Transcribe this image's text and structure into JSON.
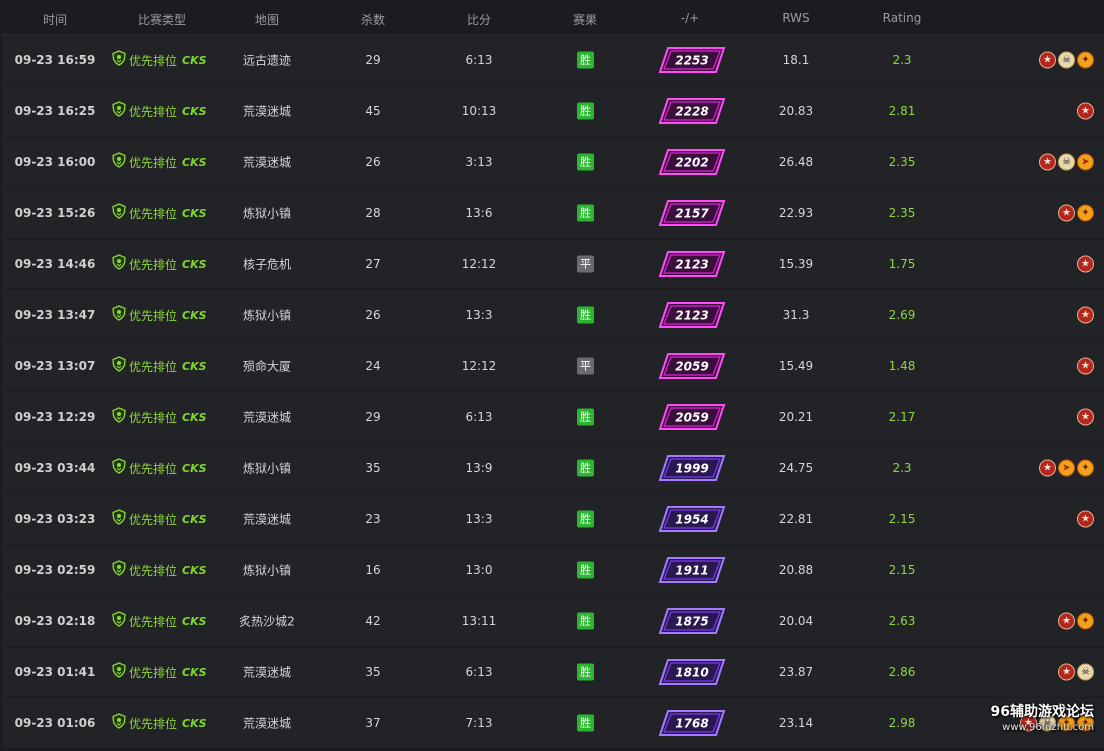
{
  "header": {
    "time": "时间",
    "type": "比赛类型",
    "map": "地图",
    "kills": "杀数",
    "score": "比分",
    "result": "赛果",
    "delta": "-/+",
    "rws": "RWS",
    "rating": "Rating"
  },
  "match_type": {
    "label": "优先排位",
    "logo": "CKS"
  },
  "result_labels": {
    "win": "胜",
    "draw": "平"
  },
  "matches": [
    {
      "time": "09-23 16:59",
      "map": "远古遗迹",
      "kills": "29",
      "score": "6:13",
      "result": "胜",
      "elo": "2253",
      "rws": "18.1",
      "rating": "2.3",
      "badges": [
        "star",
        "skull",
        "fire"
      ]
    },
    {
      "time": "09-23 16:25",
      "map": "荒漠迷城",
      "kills": "45",
      "score": "10:13",
      "result": "胜",
      "elo": "2228",
      "rws": "20.83",
      "rating": "2.81",
      "badges": [
        "star"
      ]
    },
    {
      "time": "09-23 16:00",
      "map": "荒漠迷城",
      "kills": "26",
      "score": "3:13",
      "result": "胜",
      "elo": "2202",
      "rws": "26.48",
      "rating": "2.35",
      "badges": [
        "star",
        "skull",
        "rocket"
      ]
    },
    {
      "time": "09-23 15:26",
      "map": "炼狱小镇",
      "kills": "28",
      "score": "13:6",
      "result": "胜",
      "elo": "2157",
      "rws": "22.93",
      "rating": "2.35",
      "badges": [
        "star",
        "fire"
      ]
    },
    {
      "time": "09-23 14:46",
      "map": "核子危机",
      "kills": "27",
      "score": "12:12",
      "result": "平",
      "elo": "2123",
      "rws": "15.39",
      "rating": "1.75",
      "badges": [
        "star"
      ]
    },
    {
      "time": "09-23 13:47",
      "map": "炼狱小镇",
      "kills": "26",
      "score": "13:3",
      "result": "胜",
      "elo": "2123",
      "rws": "31.3",
      "rating": "2.69",
      "badges": [
        "star"
      ]
    },
    {
      "time": "09-23 13:07",
      "map": "殒命大厦",
      "kills": "24",
      "score": "12:12",
      "result": "平",
      "elo": "2059",
      "rws": "15.49",
      "rating": "1.48",
      "badges": [
        "star"
      ]
    },
    {
      "time": "09-23 12:29",
      "map": "荒漠迷城",
      "kills": "29",
      "score": "6:13",
      "result": "胜",
      "elo": "2059",
      "rws": "20.21",
      "rating": "2.17",
      "badges": [
        "star"
      ]
    },
    {
      "time": "09-23 03:44",
      "map": "炼狱小镇",
      "kills": "35",
      "score": "13:9",
      "result": "胜",
      "elo": "1999",
      "rws": "24.75",
      "rating": "2.3",
      "badges": [
        "star",
        "rocket",
        "fire"
      ]
    },
    {
      "time": "09-23 03:23",
      "map": "荒漠迷城",
      "kills": "23",
      "score": "13:3",
      "result": "胜",
      "elo": "1954",
      "rws": "22.81",
      "rating": "2.15",
      "badges": [
        "star"
      ]
    },
    {
      "time": "09-23 02:59",
      "map": "炼狱小镇",
      "kills": "16",
      "score": "13:0",
      "result": "胜",
      "elo": "1911",
      "rws": "20.88",
      "rating": "2.15",
      "badges": []
    },
    {
      "time": "09-23 02:18",
      "map": "炙热沙城2",
      "kills": "42",
      "score": "13:11",
      "result": "胜",
      "elo": "1875",
      "rws": "20.04",
      "rating": "2.63",
      "badges": [
        "star",
        "fire"
      ]
    },
    {
      "time": "09-23 01:41",
      "map": "荒漠迷城",
      "kills": "35",
      "score": "6:13",
      "result": "胜",
      "elo": "1810",
      "rws": "23.87",
      "rating": "2.86",
      "badges": [
        "star",
        "skull"
      ]
    },
    {
      "time": "09-23 01:06",
      "map": "荒漠迷城",
      "kills": "37",
      "score": "7:13",
      "result": "胜",
      "elo": "1768",
      "rws": "23.14",
      "rating": "2.98",
      "badges": [
        "star",
        "skull",
        "fire",
        "fire"
      ]
    }
  ],
  "badge_icons": {
    "star": "★",
    "skull": "☠",
    "fire": "✦",
    "rocket": "➤"
  },
  "colors": {
    "win": "#2bb531",
    "draw": "#6c6c70",
    "rating": "#8fd83a",
    "elo_pink": "#e020d8",
    "elo_purple": "#7a3cf0"
  },
  "watermark": {
    "title": "96辅助游戏论坛",
    "url": "www.96fuzhu.com"
  }
}
